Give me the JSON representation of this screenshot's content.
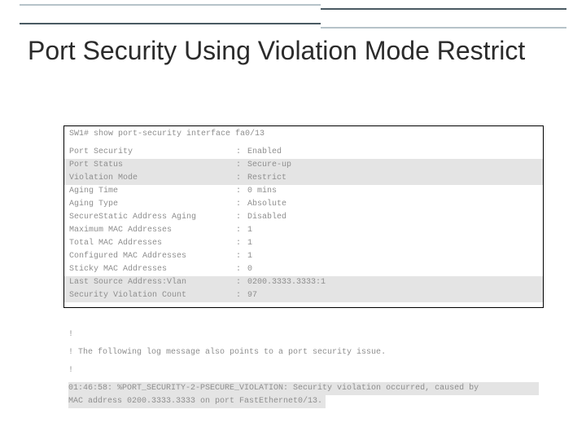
{
  "title": "Port Security Using Violation Mode Restrict",
  "cmd": "SW1# show port-security interface fa0/13",
  "colon": ":",
  "rows": [
    {
      "key": "Port Security",
      "val": "Enabled",
      "hl": false
    },
    {
      "key": "Port Status",
      "val": "Secure-up",
      "hl": true
    },
    {
      "key": "Violation Mode",
      "val": "Restrict",
      "hl": true
    },
    {
      "key": "Aging Time",
      "val": "0 mins",
      "hl": false
    },
    {
      "key": "Aging Type",
      "val": "Absolute",
      "hl": false
    },
    {
      "key": "SecureStatic Address Aging",
      "val": "Disabled",
      "hl": false
    },
    {
      "key": "Maximum MAC Addresses",
      "val": "1",
      "hl": false
    },
    {
      "key": "Total MAC Addresses",
      "val": "1",
      "hl": false
    },
    {
      "key": "Configured MAC Addresses",
      "val": "1",
      "hl": false
    },
    {
      "key": "Sticky MAC Addresses",
      "val": "0",
      "hl": false
    },
    {
      "key": "Last Source Address:Vlan",
      "val": "0200.3333.3333:1",
      "hl": true
    },
    {
      "key": "Security Violation Count",
      "val": "97",
      "hl": true
    }
  ],
  "note": {
    "bang": "!",
    "msg": "! The following log message also points to a port security issue.",
    "log1": "01:46:58: %PORT_SECURITY-2-PSECURE_VIOLATION: Security violation occurred, caused by",
    "log2": "MAC address 0200.3333.3333 on port FastEthernet0/13."
  }
}
